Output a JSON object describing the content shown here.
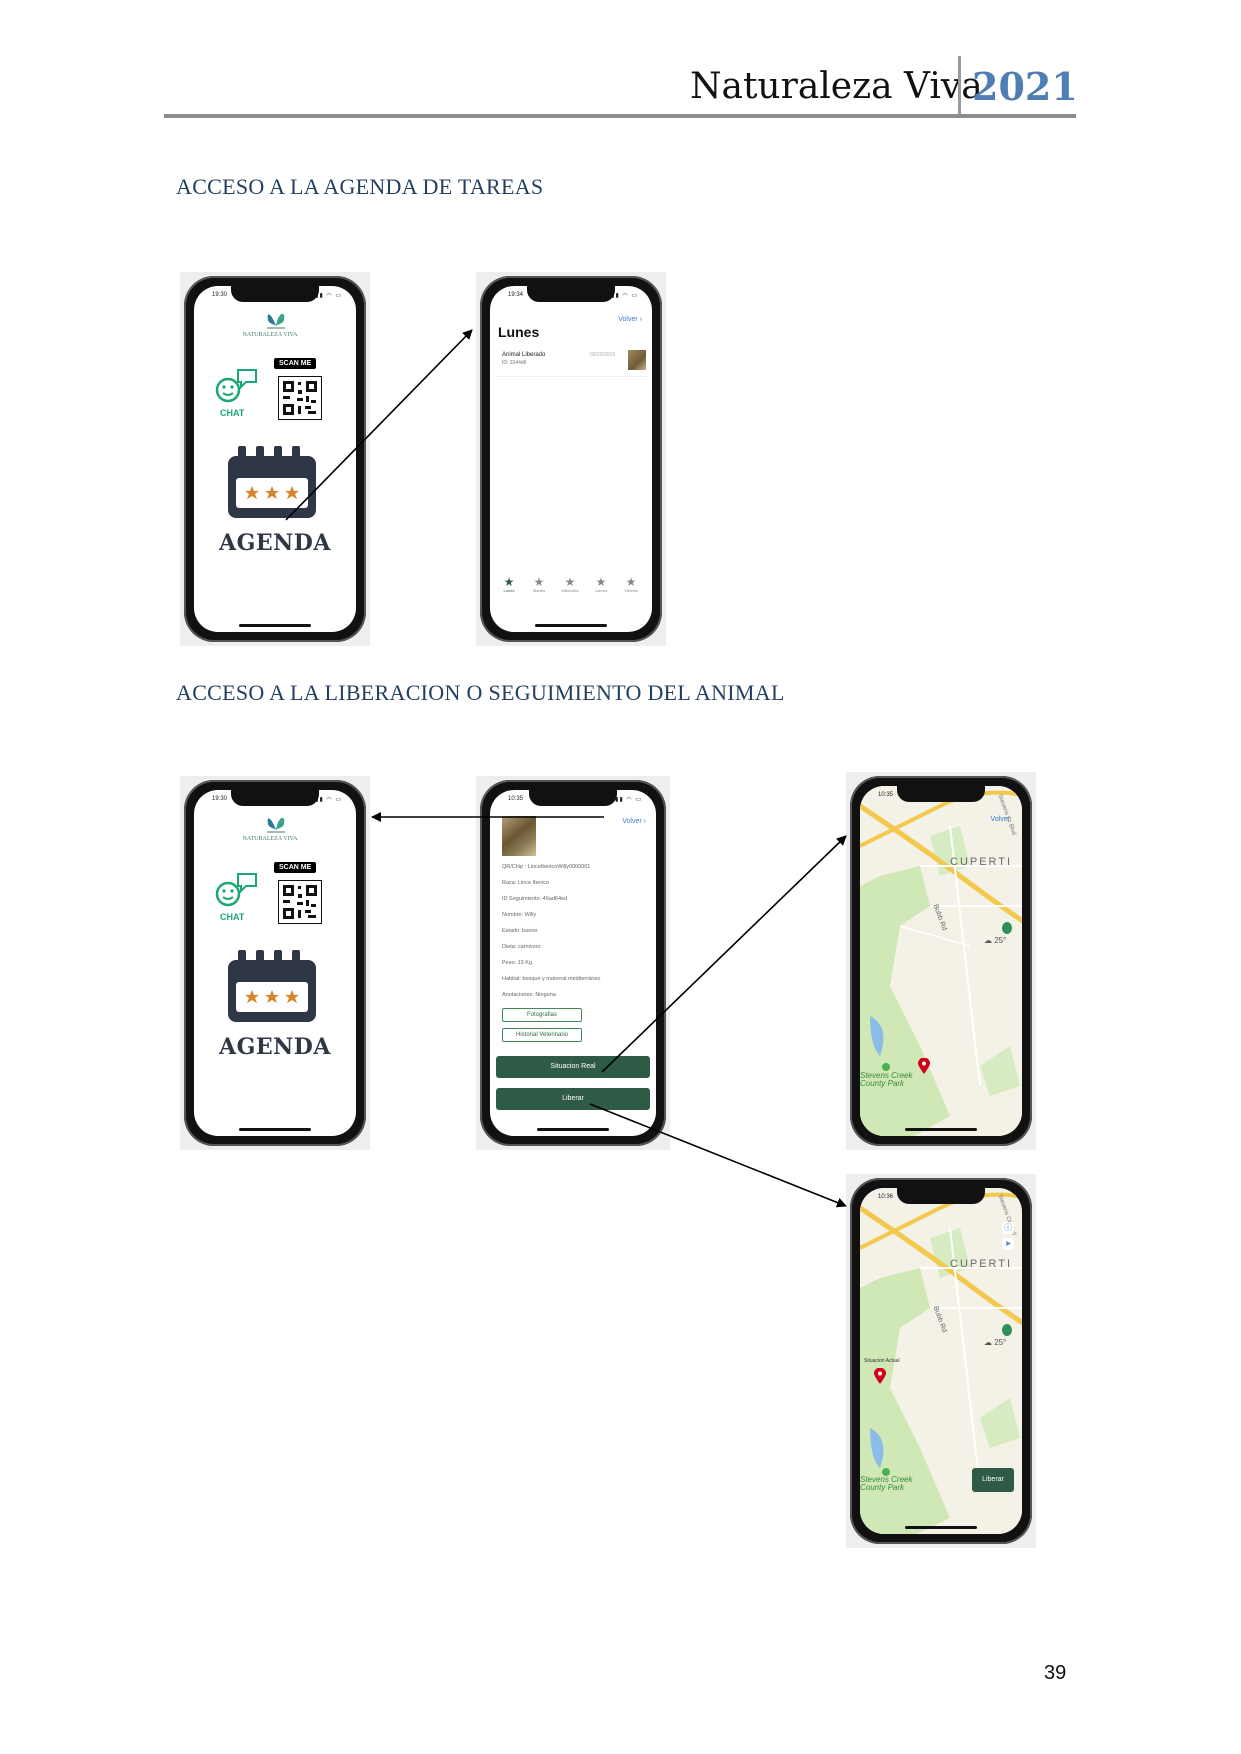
{
  "header": {
    "title": "Naturaleza Viva",
    "year": "2021"
  },
  "sections": [
    "ACCESO A LA AGENDA DE TAREAS",
    "ACCESO A LA LIBERACION O SEGUIMIENTO DEL ANIMAL"
  ],
  "home_screen": {
    "time": "19:30",
    "logo_text": "NATURALEZA VIVA",
    "scan_me": "SCAN ME",
    "chat_label": "CHAT",
    "agenda_label": "AGENDA"
  },
  "agenda_screen": {
    "time": "19:34",
    "back_label": "Volver",
    "day_title": "Lunes",
    "task": {
      "title": "Animal Liberado",
      "id": "ID: 3344d6",
      "date": "02/20/2019"
    },
    "tabs": [
      "Lunes",
      "Martes",
      "Miercoles",
      "Jueves",
      "Viernes"
    ]
  },
  "detail_screen": {
    "time": "10:35",
    "back_label": "Volver",
    "fields": [
      "QR/Chip : LinceIbericoWilly0000001",
      "Raza: Lince Iberico",
      "ID Seguimiento: 46ad64ed",
      "Nombre: Willy",
      "Estado: bueno",
      "Dieta: carnivoro",
      "Peso: 13 Kg",
      "Habitat: bosque y matorral mediterráneo",
      "Anotaciones: Ninguna"
    ],
    "photos_button": "Fotografias",
    "history_button": "Historial Veterinario",
    "situation_button": "Situacion Real",
    "release_button": "Liberar"
  },
  "map_screen_1": {
    "time": "10:35",
    "back_label": "Volver",
    "city": "CUPERTI",
    "road": "Bubb Rd",
    "road_2": "Stevens Cr Blvd",
    "park": "Stevens Creek\nCounty Park",
    "temp": "25°"
  },
  "map_screen_2": {
    "time": "10:36",
    "city": "CUPERTI",
    "road": "Bubb Rd",
    "road_2": "Stevens Cr Blvd",
    "park": "Stevens Creek\nCounty Park",
    "temp": "25°",
    "pin_label": "Situacion Actual",
    "release_button": "Liberar"
  },
  "colors": {
    "accent": "#4f7db5",
    "section": "#243f60",
    "button_green": "#2f5a45",
    "chat_green": "#1aa872"
  },
  "page_number": "39"
}
